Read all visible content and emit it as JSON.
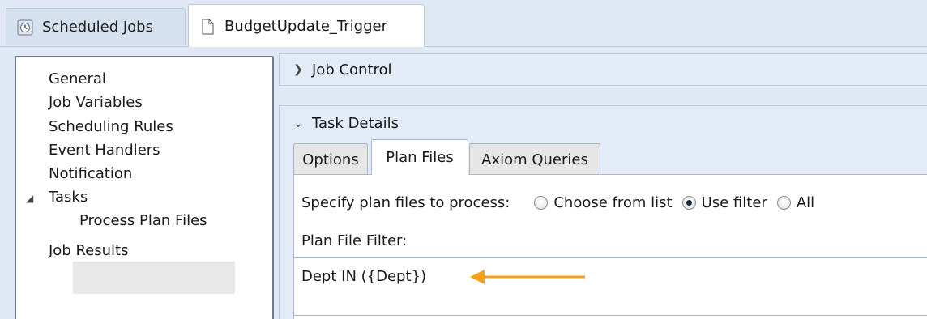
{
  "tabs": [
    {
      "label": "Scheduled Jobs",
      "icon": "scheduled-jobs-icon",
      "active": false
    },
    {
      "label": "BudgetUpdate_Trigger",
      "icon": "document-icon",
      "active": true
    }
  ],
  "sidebar": {
    "items": [
      {
        "label": "General"
      },
      {
        "label": "Job Variables"
      },
      {
        "label": "Scheduling Rules"
      },
      {
        "label": "Event Handlers"
      },
      {
        "label": "Notification"
      },
      {
        "label": "Tasks",
        "expanded": true
      },
      {
        "label": "Process Plan Files",
        "selected": true
      },
      {
        "label": "Job Results"
      }
    ]
  },
  "sections": {
    "job_control": {
      "label": "Job Control",
      "expanded": false
    },
    "task_details": {
      "label": "Task Details",
      "expanded": true
    }
  },
  "subtabs": [
    {
      "label": "Options",
      "active": false
    },
    {
      "label": "Plan Files",
      "active": true
    },
    {
      "label": "Axiom Queries",
      "active": false
    }
  ],
  "plan_files": {
    "specify_label": "Specify plan files to process:",
    "options": [
      {
        "label": "Choose from list",
        "checked": false
      },
      {
        "label": "Use filter",
        "checked": true
      },
      {
        "label": "All",
        "checked": false
      }
    ],
    "filter_label": "Plan File Filter:",
    "filter_value": "Dept IN ({Dept})"
  },
  "colors": {
    "accent_arrow": "#f7a11a",
    "panel_bg": "#dfe8f4"
  }
}
